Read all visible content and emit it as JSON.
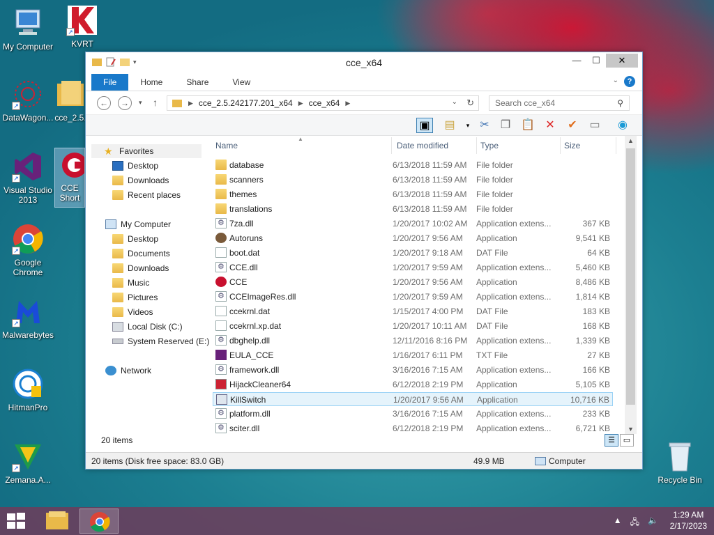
{
  "desktop": {
    "icons": [
      {
        "label": "My Computer"
      },
      {
        "label": "KVRT"
      },
      {
        "label": "DataWagon..."
      },
      {
        "label": "cce_2.5."
      },
      {
        "label": "Visual Studio 2013"
      },
      {
        "label": "CCE Short"
      },
      {
        "label": "Google Chrome"
      },
      {
        "label": "Malwarebytes"
      },
      {
        "label": "HitmanPro"
      },
      {
        "label": "Zemana.A..."
      },
      {
        "label": "Recycle Bin"
      }
    ]
  },
  "window": {
    "title": "cce_x64",
    "tabs": [
      "File",
      "Home",
      "Share",
      "View"
    ],
    "help": "?",
    "address": {
      "segments": [
        "cce_2.5.242177.201_x64",
        "cce_x64"
      ]
    },
    "search_placeholder": "Search cce_x64",
    "nav": {
      "favorites": "Favorites",
      "favorites_items": [
        "Desktop",
        "Downloads",
        "Recent places"
      ],
      "computer": "My Computer",
      "computer_items": [
        "Desktop",
        "Documents",
        "Downloads",
        "Music",
        "Pictures",
        "Videos",
        "Local Disk (C:)",
        "System Reserved (E:)"
      ],
      "network": "Network"
    },
    "columns": [
      "Name",
      "Date modified",
      "Type",
      "Size"
    ],
    "files": [
      {
        "name": "database",
        "date": "6/13/2018 11:59 AM",
        "type": "File folder",
        "size": "",
        "icon": "folder"
      },
      {
        "name": "scanners",
        "date": "6/13/2018 11:59 AM",
        "type": "File folder",
        "size": "",
        "icon": "folder"
      },
      {
        "name": "themes",
        "date": "6/13/2018 11:59 AM",
        "type": "File folder",
        "size": "",
        "icon": "folder"
      },
      {
        "name": "translations",
        "date": "6/13/2018 11:59 AM",
        "type": "File folder",
        "size": "",
        "icon": "folder"
      },
      {
        "name": "7za.dll",
        "date": "1/20/2017 10:02 AM",
        "type": "Application extens...",
        "size": "367 KB",
        "icon": "dll"
      },
      {
        "name": "Autoruns",
        "date": "1/20/2017 9:56 AM",
        "type": "Application",
        "size": "9,541 KB",
        "icon": "autoruns"
      },
      {
        "name": "boot.dat",
        "date": "1/20/2017 9:18 AM",
        "type": "DAT File",
        "size": "64 KB",
        "icon": "file"
      },
      {
        "name": "CCE.dll",
        "date": "1/20/2017 9:59 AM",
        "type": "Application extens...",
        "size": "5,460 KB",
        "icon": "dll"
      },
      {
        "name": "CCE",
        "date": "1/20/2017 9:56 AM",
        "type": "Application",
        "size": "8,486 KB",
        "icon": "cce"
      },
      {
        "name": "CCEImageRes.dll",
        "date": "1/20/2017 9:59 AM",
        "type": "Application extens...",
        "size": "1,814 KB",
        "icon": "dll"
      },
      {
        "name": "ccekrnl.dat",
        "date": "1/15/2017 4:00 PM",
        "type": "DAT File",
        "size": "183 KB",
        "icon": "file"
      },
      {
        "name": "ccekrnl.xp.dat",
        "date": "1/20/2017 10:11 AM",
        "type": "DAT File",
        "size": "168 KB",
        "icon": "file"
      },
      {
        "name": "dbghelp.dll",
        "date": "12/11/2016 8:16 PM",
        "type": "Application extens...",
        "size": "1,339 KB",
        "icon": "dll"
      },
      {
        "name": "EULA_CCE",
        "date": "1/16/2017 6:11 PM",
        "type": "TXT File",
        "size": "27 KB",
        "icon": "vs"
      },
      {
        "name": "framework.dll",
        "date": "3/16/2016 7:15 AM",
        "type": "Application extens...",
        "size": "166 KB",
        "icon": "dll"
      },
      {
        "name": "HijackCleaner64",
        "date": "6/12/2018 2:19 PM",
        "type": "Application",
        "size": "5,105 KB",
        "icon": "hijack"
      },
      {
        "name": "KillSwitch",
        "date": "1/20/2017 9:56 AM",
        "type": "Application",
        "size": "10,716 KB",
        "icon": "killswitch"
      },
      {
        "name": "platform.dll",
        "date": "3/16/2016 7:15 AM",
        "type": "Application extens...",
        "size": "233 KB",
        "icon": "dll"
      },
      {
        "name": "sciter.dll",
        "date": "6/12/2018 2:19 PM",
        "type": "Application extens...",
        "size": "6,721 KB",
        "icon": "dll"
      }
    ],
    "selected_index": 16,
    "item_count": "20 items",
    "status": {
      "left": "20 items (Disk free space: 83.0 GB)",
      "size": "49.9 MB",
      "location": "Computer"
    }
  },
  "taskbar": {
    "time": "1:29 AM",
    "date": "2/17/2023"
  }
}
